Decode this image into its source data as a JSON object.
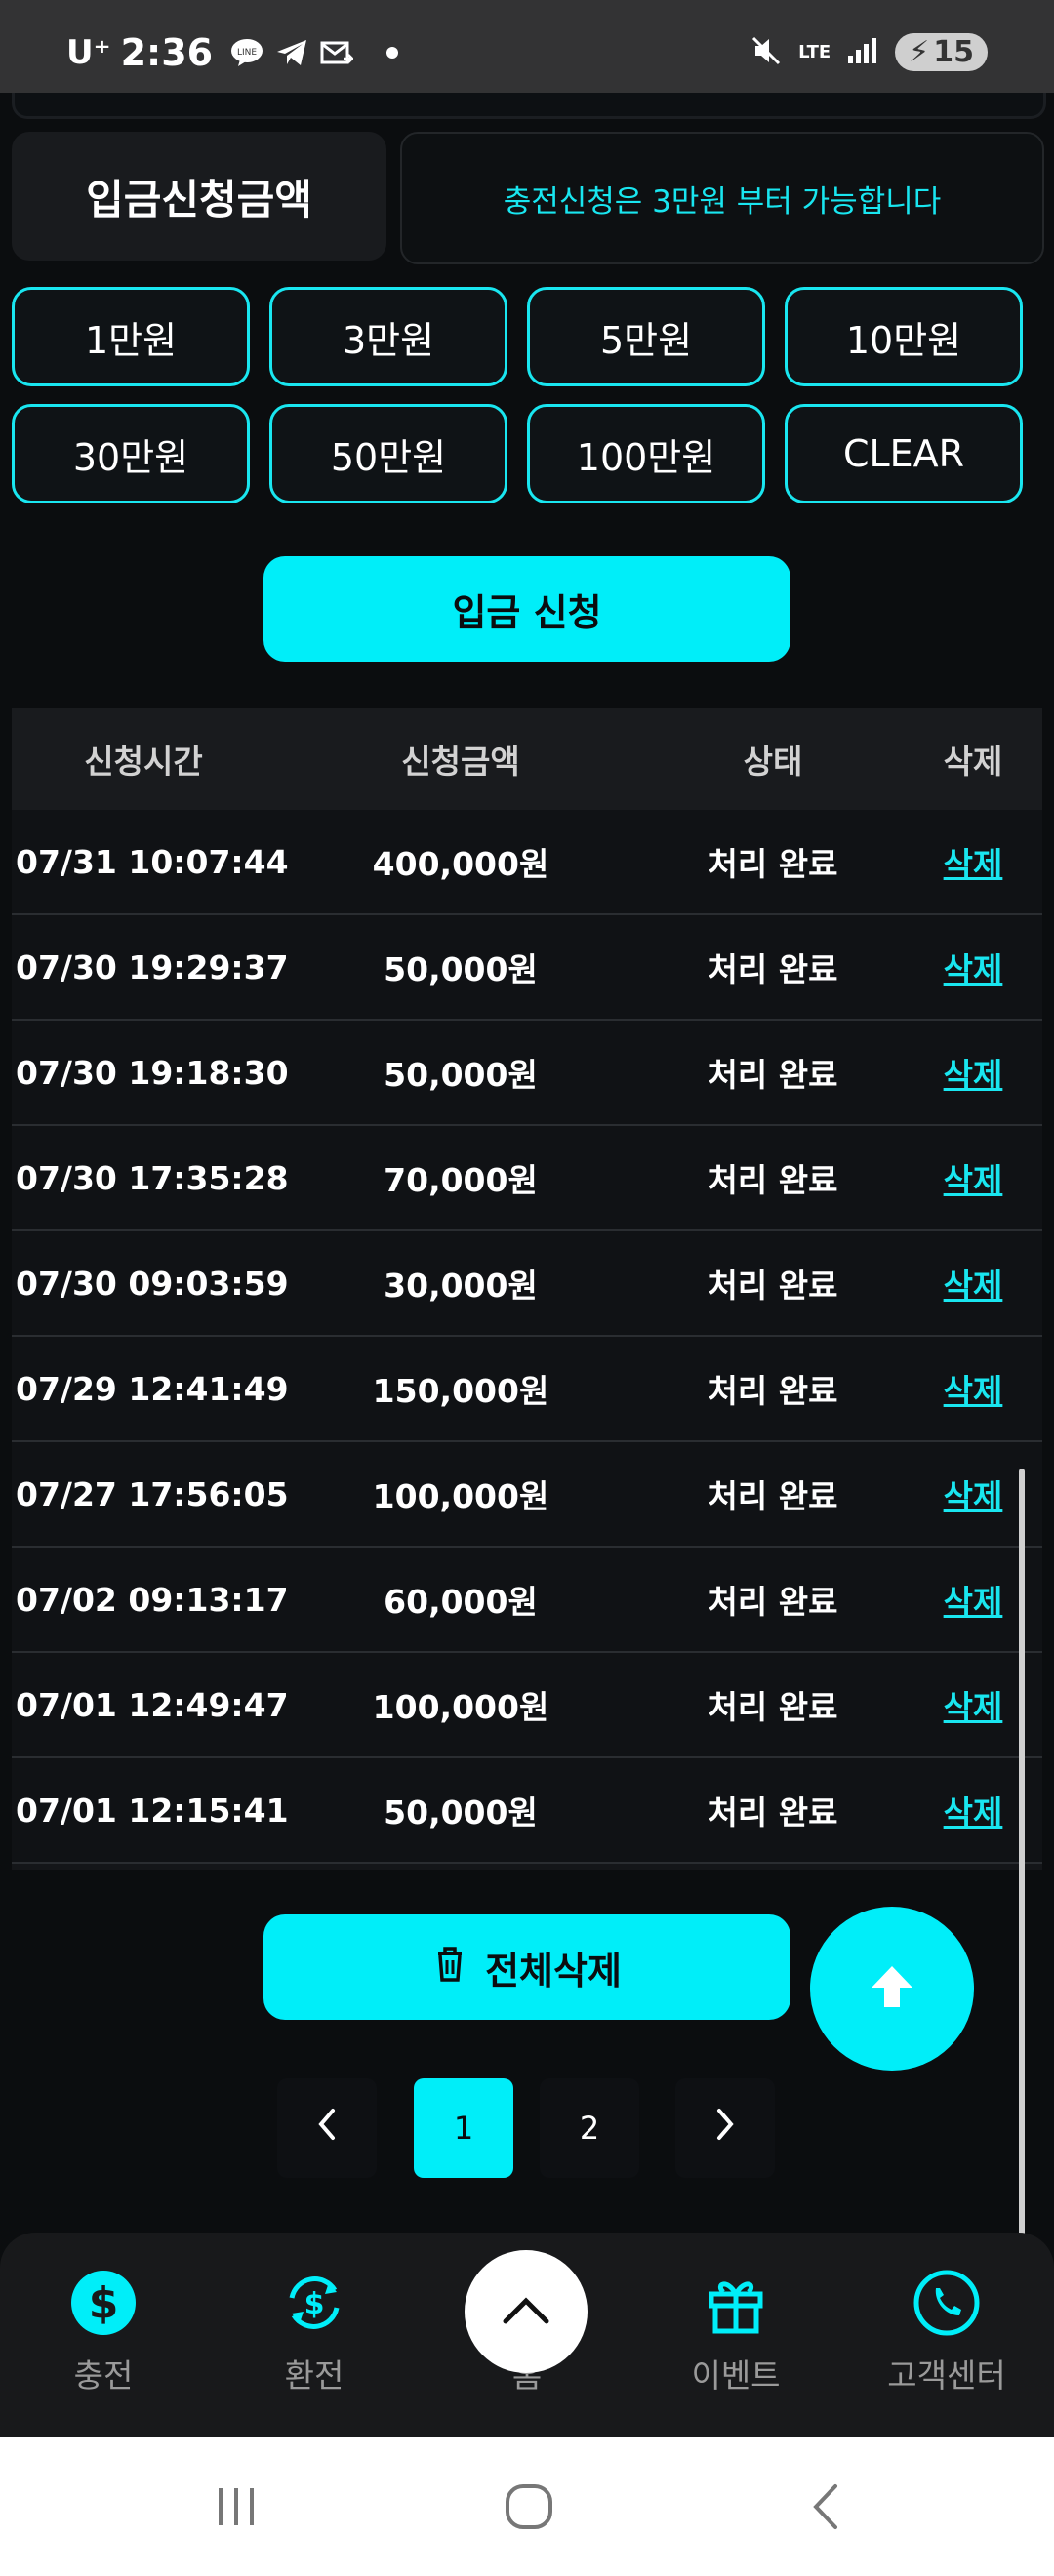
{
  "status_bar": {
    "carrier": "U⁺",
    "time": "2:36",
    "icons": [
      "line-icon",
      "telegram-icon",
      "mail-icon",
      "dot-icon"
    ],
    "network": "LTE",
    "battery": "15"
  },
  "deposit": {
    "label": "입금신청금액",
    "notice": "충전신청은 3만원 부터 가능합니다",
    "amount_buttons": [
      "1만원",
      "3만원",
      "5만원",
      "10만원",
      "30만원",
      "50만원",
      "100만원",
      "CLEAR"
    ],
    "submit_label": "입금 신청"
  },
  "table": {
    "headers": [
      "신청시간",
      "신청금액",
      "상태",
      "삭제"
    ],
    "rows": [
      {
        "time": "07/31 10:07:44",
        "amount": "400,000원",
        "status": "처리 완료",
        "delete": "삭제"
      },
      {
        "time": "07/30 19:29:37",
        "amount": "50,000원",
        "status": "처리 완료",
        "delete": "삭제"
      },
      {
        "time": "07/30 19:18:30",
        "amount": "50,000원",
        "status": "처리 완료",
        "delete": "삭제"
      },
      {
        "time": "07/30 17:35:28",
        "amount": "70,000원",
        "status": "처리 완료",
        "delete": "삭제"
      },
      {
        "time": "07/30 09:03:59",
        "amount": "30,000원",
        "status": "처리 완료",
        "delete": "삭제"
      },
      {
        "time": "07/29 12:41:49",
        "amount": "150,000원",
        "status": "처리 완료",
        "delete": "삭제"
      },
      {
        "time": "07/27 17:56:05",
        "amount": "100,000원",
        "status": "처리 완료",
        "delete": "삭제"
      },
      {
        "time": "07/02 09:13:17",
        "amount": "60,000원",
        "status": "처리 완료",
        "delete": "삭제"
      },
      {
        "time": "07/01 12:49:47",
        "amount": "100,000원",
        "status": "처리 완료",
        "delete": "삭제"
      },
      {
        "time": "07/01 12:15:41",
        "amount": "50,000원",
        "status": "처리 완료",
        "delete": "삭제"
      }
    ]
  },
  "delete_all_label": "전체삭제",
  "pagination": {
    "pages": [
      "1",
      "2"
    ],
    "active": "1"
  },
  "bottom_nav": [
    {
      "label": "충전",
      "icon": "dollar-circle-icon",
      "active": true
    },
    {
      "label": "환전",
      "icon": "exchange-icon",
      "active": false
    },
    {
      "label": "홈",
      "icon": "chevron-up-icon",
      "active": false
    },
    {
      "label": "이벤트",
      "icon": "gift-icon",
      "active": false
    },
    {
      "label": "고객센터",
      "icon": "phone-icon",
      "active": false
    }
  ],
  "colors": {
    "accent": "#00eef9",
    "background": "#0b0d0f",
    "panel": "#191b1e"
  }
}
